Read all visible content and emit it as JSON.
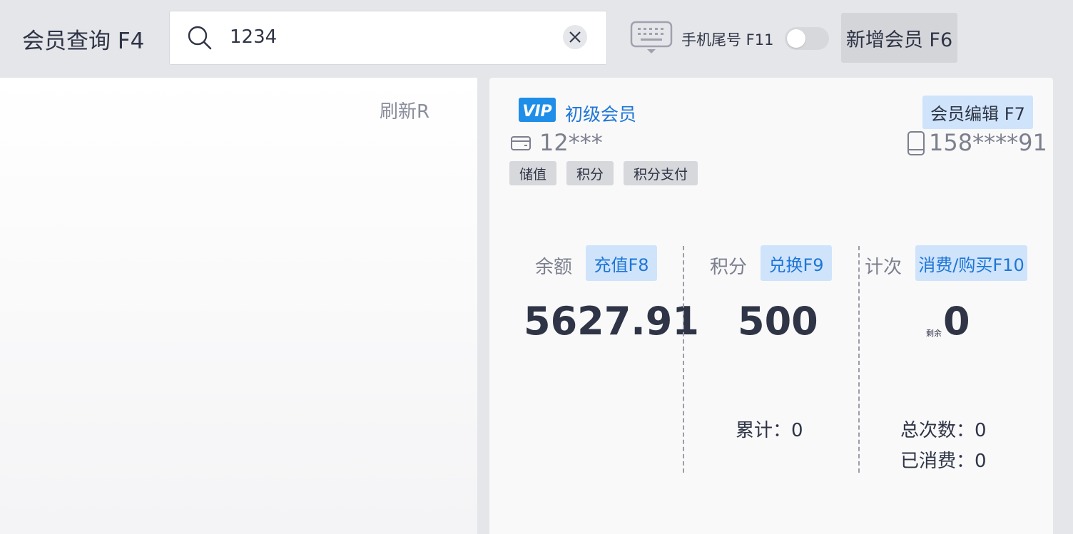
{
  "header": {
    "title": "会员查询 F4",
    "search_value": "1234",
    "search_icon": "search-icon",
    "clear_icon": "close-icon",
    "keyboard_icon": "keyboard-icon",
    "phone_tail_label": "手机尾号 F11",
    "phone_tail_toggle_on": false,
    "add_member_label": "新增会员 F6"
  },
  "left_panel": {
    "refresh_label": "刷新R"
  },
  "member": {
    "vip_badge": "VIP",
    "level": "初级会员",
    "edit_label": "会员编辑 F7",
    "card_no": "12***",
    "phone": "158****91",
    "tags": [
      "储值",
      "积分",
      "积分支付"
    ]
  },
  "stats": {
    "balance": {
      "label": "余额",
      "button": "充值F8",
      "value": "5627.91"
    },
    "points": {
      "label": "积分",
      "button": "兑换F9",
      "value": "500",
      "cumulative": "累计：0"
    },
    "count": {
      "label": "计次",
      "button": "消费/购买F10",
      "remain_prefix": "剩余",
      "value": "0",
      "total": "总次数：0",
      "used": "已消费：0"
    }
  },
  "colors": {
    "accent": "#1e76d6",
    "button_light": "#cfe4fb",
    "background": "#e5e6ea"
  }
}
